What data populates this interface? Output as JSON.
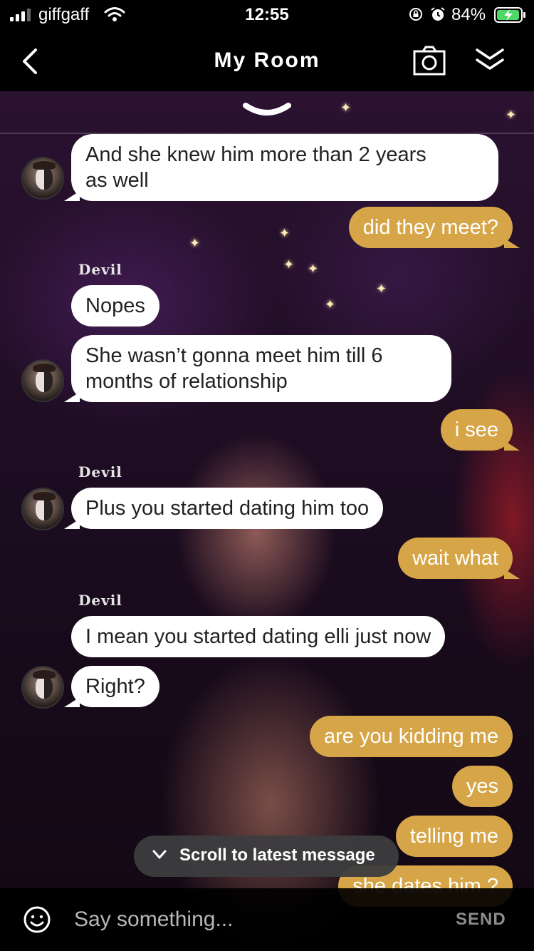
{
  "status_bar": {
    "carrier": "giffgaff",
    "time": "12:55",
    "battery_percent": "84%"
  },
  "header": {
    "title": "My Room",
    "back_icon": "chevron-left-icon",
    "camera_icon": "camera-icon",
    "collapse_icon": "double-chevron-down-icon"
  },
  "colors": {
    "outgoing_bubble": "#d6a548",
    "incoming_bubble": "#ffffff",
    "header_bg": "#000000"
  },
  "messages": [
    {
      "id": "m1",
      "direction": "in",
      "line1": "And she knew him more than 2 years",
      "line2": "as well"
    },
    {
      "id": "m2",
      "direction": "out",
      "text": "did they meet?"
    },
    {
      "id": "m3",
      "direction": "in",
      "sender": "Devil",
      "text": "Nopes"
    },
    {
      "id": "m4",
      "direction": "in",
      "line1": "She wasn’t gonna meet him till 6",
      "line2": "months of relationship"
    },
    {
      "id": "m5",
      "direction": "out",
      "text": "i see"
    },
    {
      "id": "m6",
      "direction": "in",
      "sender": "Devil",
      "text": "Plus you started dating him too"
    },
    {
      "id": "m7",
      "direction": "out",
      "text": "wait what"
    },
    {
      "id": "m8",
      "direction": "in",
      "sender": "Devil",
      "text": "I mean you started dating elli just now"
    },
    {
      "id": "m9",
      "direction": "in",
      "text": "Right?"
    },
    {
      "id": "m10",
      "direction": "out",
      "text": "are you kidding me"
    },
    {
      "id": "m11",
      "direction": "out",
      "text": "yes"
    },
    {
      "id": "m12",
      "direction": "out",
      "text": "telling me"
    },
    {
      "id": "m13",
      "direction": "out",
      "text": "she dates him ?"
    }
  ],
  "scroll_button": {
    "label": "Scroll to latest message"
  },
  "composer": {
    "placeholder": "Say something...",
    "send_label": "SEND"
  }
}
